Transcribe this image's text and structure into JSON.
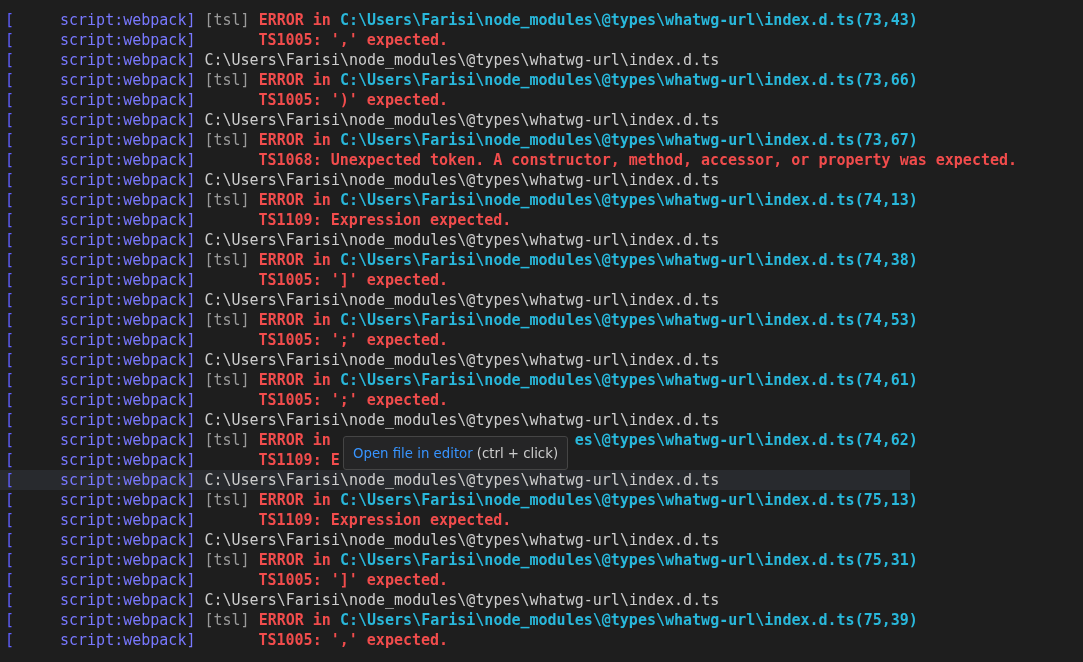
{
  "terminal": {
    "lines": [
      {
        "kind": "error",
        "bracket": "[",
        "source": "script:webpack]",
        "tag": "[tsl]",
        "label": "ERROR in",
        "file": "C:\\Users\\Farisi\\node_modules\\@types\\whatwg-url\\index.d.ts(73,43)",
        "highlighted": false
      },
      {
        "kind": "message",
        "bracket": "[",
        "source": "script:webpack]",
        "text": "TS1005: ',' expected.",
        "highlighted": false
      },
      {
        "kind": "path",
        "bracket": "[",
        "source": "script:webpack]",
        "text": "C:\\Users\\Farisi\\node_modules\\@types\\whatwg-url\\index.d.ts",
        "highlighted": false
      },
      {
        "kind": "error",
        "bracket": "[",
        "source": "script:webpack]",
        "tag": "[tsl]",
        "label": "ERROR in",
        "file": "C:\\Users\\Farisi\\node_modules\\@types\\whatwg-url\\index.d.ts(73,66)",
        "highlighted": false
      },
      {
        "kind": "message",
        "bracket": "[",
        "source": "script:webpack]",
        "text": "TS1005: ')' expected.",
        "highlighted": false
      },
      {
        "kind": "path",
        "bracket": "[",
        "source": "script:webpack]",
        "text": "C:\\Users\\Farisi\\node_modules\\@types\\whatwg-url\\index.d.ts",
        "highlighted": false
      },
      {
        "kind": "error",
        "bracket": "[",
        "source": "script:webpack]",
        "tag": "[tsl]",
        "label": "ERROR in",
        "file": "C:\\Users\\Farisi\\node_modules\\@types\\whatwg-url\\index.d.ts(73,67)",
        "highlighted": false
      },
      {
        "kind": "message",
        "bracket": "[",
        "source": "script:webpack]",
        "text": "TS1068: Unexpected token. A constructor, method, accessor, or property was expected.",
        "highlighted": false
      },
      {
        "kind": "path",
        "bracket": "[",
        "source": "script:webpack]",
        "text": "C:\\Users\\Farisi\\node_modules\\@types\\whatwg-url\\index.d.ts",
        "highlighted": false
      },
      {
        "kind": "error",
        "bracket": "[",
        "source": "script:webpack]",
        "tag": "[tsl]",
        "label": "ERROR in",
        "file": "C:\\Users\\Farisi\\node_modules\\@types\\whatwg-url\\index.d.ts(74,13)",
        "highlighted": false
      },
      {
        "kind": "message",
        "bracket": "[",
        "source": "script:webpack]",
        "text": "TS1109: Expression expected.",
        "highlighted": false
      },
      {
        "kind": "path",
        "bracket": "[",
        "source": "script:webpack]",
        "text": "C:\\Users\\Farisi\\node_modules\\@types\\whatwg-url\\index.d.ts",
        "highlighted": false
      },
      {
        "kind": "error",
        "bracket": "[",
        "source": "script:webpack]",
        "tag": "[tsl]",
        "label": "ERROR in",
        "file": "C:\\Users\\Farisi\\node_modules\\@types\\whatwg-url\\index.d.ts(74,38)",
        "highlighted": false
      },
      {
        "kind": "message",
        "bracket": "[",
        "source": "script:webpack]",
        "text": "TS1005: ']' expected.",
        "highlighted": false
      },
      {
        "kind": "path",
        "bracket": "[",
        "source": "script:webpack]",
        "text": "C:\\Users\\Farisi\\node_modules\\@types\\whatwg-url\\index.d.ts",
        "highlighted": false
      },
      {
        "kind": "error",
        "bracket": "[",
        "source": "script:webpack]",
        "tag": "[tsl]",
        "label": "ERROR in",
        "file": "C:\\Users\\Farisi\\node_modules\\@types\\whatwg-url\\index.d.ts(74,53)",
        "highlighted": false
      },
      {
        "kind": "message",
        "bracket": "[",
        "source": "script:webpack]",
        "text": "TS1005: ';' expected.",
        "highlighted": false
      },
      {
        "kind": "path",
        "bracket": "[",
        "source": "script:webpack]",
        "text": "C:\\Users\\Farisi\\node_modules\\@types\\whatwg-url\\index.d.ts",
        "highlighted": false
      },
      {
        "kind": "error",
        "bracket": "[",
        "source": "script:webpack]",
        "tag": "[tsl]",
        "label": "ERROR in",
        "file": "C:\\Users\\Farisi\\node_modules\\@types\\whatwg-url\\index.d.ts(74,61)",
        "highlighted": false
      },
      {
        "kind": "message",
        "bracket": "[",
        "source": "script:webpack]",
        "text": "TS1005: ';' expected.",
        "highlighted": false
      },
      {
        "kind": "path",
        "bracket": "[",
        "source": "script:webpack]",
        "text": "C:\\Users\\Farisi\\node_modules\\@types\\whatwg-url\\index.d.ts",
        "highlighted": false
      },
      {
        "kind": "covered_error",
        "bracket": "[",
        "source": "script:webpack]",
        "tag": "[tsl]",
        "label": "ERROR in",
        "file": "es\\@types\\whatwg-url\\index.d.ts(74,62)",
        "highlighted": false
      },
      {
        "kind": "message",
        "bracket": "[",
        "source": "script:webpack]",
        "text": "TS1109: E",
        "highlighted": false
      },
      {
        "kind": "path",
        "bracket": "[",
        "source": "script:webpack]",
        "text": "C:\\Users\\Farisi\\node_modules\\@types\\whatwg-url\\index.d.ts",
        "highlighted": true
      },
      {
        "kind": "error",
        "bracket": "[",
        "source": "script:webpack]",
        "tag": "[tsl]",
        "label": "ERROR in",
        "file": "C:\\Users\\Farisi\\node_modules\\@types\\whatwg-url\\index.d.ts(75,13)",
        "highlighted": false
      },
      {
        "kind": "message",
        "bracket": "[",
        "source": "script:webpack]",
        "text": "TS1109: Expression expected.",
        "highlighted": false
      },
      {
        "kind": "path",
        "bracket": "[",
        "source": "script:webpack]",
        "text": "C:\\Users\\Farisi\\node_modules\\@types\\whatwg-url\\index.d.ts",
        "highlighted": false
      },
      {
        "kind": "error",
        "bracket": "[",
        "source": "script:webpack]",
        "tag": "[tsl]",
        "label": "ERROR in",
        "file": "C:\\Users\\Farisi\\node_modules\\@types\\whatwg-url\\index.d.ts(75,31)",
        "highlighted": false
      },
      {
        "kind": "message",
        "bracket": "[",
        "source": "script:webpack]",
        "text": "TS1005: ']' expected.",
        "highlighted": false
      },
      {
        "kind": "path",
        "bracket": "[",
        "source": "script:webpack]",
        "text": "C:\\Users\\Farisi\\node_modules\\@types\\whatwg-url\\index.d.ts",
        "highlighted": false
      },
      {
        "kind": "error",
        "bracket": "[",
        "source": "script:webpack]",
        "tag": "[tsl]",
        "label": "ERROR in",
        "file": "C:\\Users\\Farisi\\node_modules\\@types\\whatwg-url\\index.d.ts(75,39)",
        "highlighted": false
      },
      {
        "kind": "message",
        "bracket": "[",
        "source": "script:webpack]",
        "text": "TS1005: ',' expected.",
        "highlighted": false
      }
    ]
  },
  "tooltip": {
    "link": "Open file in editor",
    "hint": "(ctrl + click)"
  }
}
